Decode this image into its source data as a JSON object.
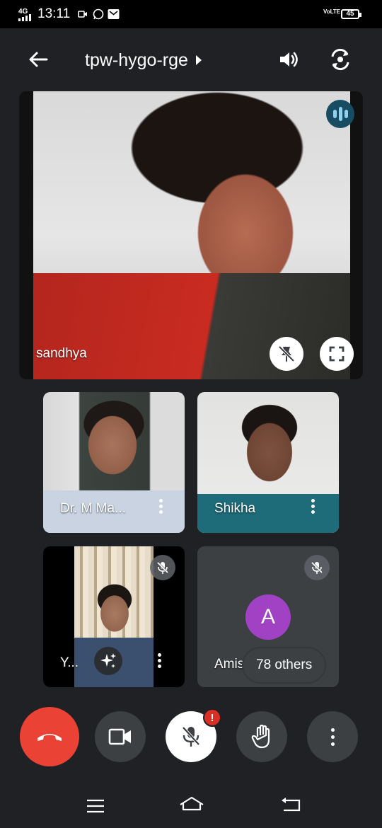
{
  "status_bar": {
    "network": "4G",
    "time": "13:11",
    "volte": "VoLTE",
    "battery": "45"
  },
  "header": {
    "meeting_code": "tpw-hygo-rge",
    "back_icon": "arrow-left-icon",
    "speaker_icon": "volume-icon",
    "switch_camera_icon": "camera-switch-icon"
  },
  "main_participant": {
    "name": "sandhya",
    "speaking_icon": "audio-bars-icon",
    "unpin_icon": "unpin-icon",
    "fullscreen_icon": "fullscreen-icon"
  },
  "participants": [
    {
      "name": "Dr. M Ma...",
      "muted": false
    },
    {
      "name": "Shikha",
      "muted": false
    },
    {
      "name": "Y...",
      "muted": true
    },
    {
      "name": "Amish",
      "muted": true,
      "avatar_letter": "A",
      "avatar_color": "#a142c4"
    }
  ],
  "overflow": {
    "label": "78 others"
  },
  "controls": {
    "end_call_icon": "end-call-icon",
    "camera_icon": "video-camera-icon",
    "mic_icon": "mic-off-icon",
    "mic_alert": "!",
    "raise_hand_icon": "raise-hand-icon",
    "more_icon": "more-vert-icon"
  },
  "colors": {
    "background": "#202124",
    "end_call": "#ea4335",
    "avatar": "#a142c4",
    "alert": "#d93025"
  }
}
